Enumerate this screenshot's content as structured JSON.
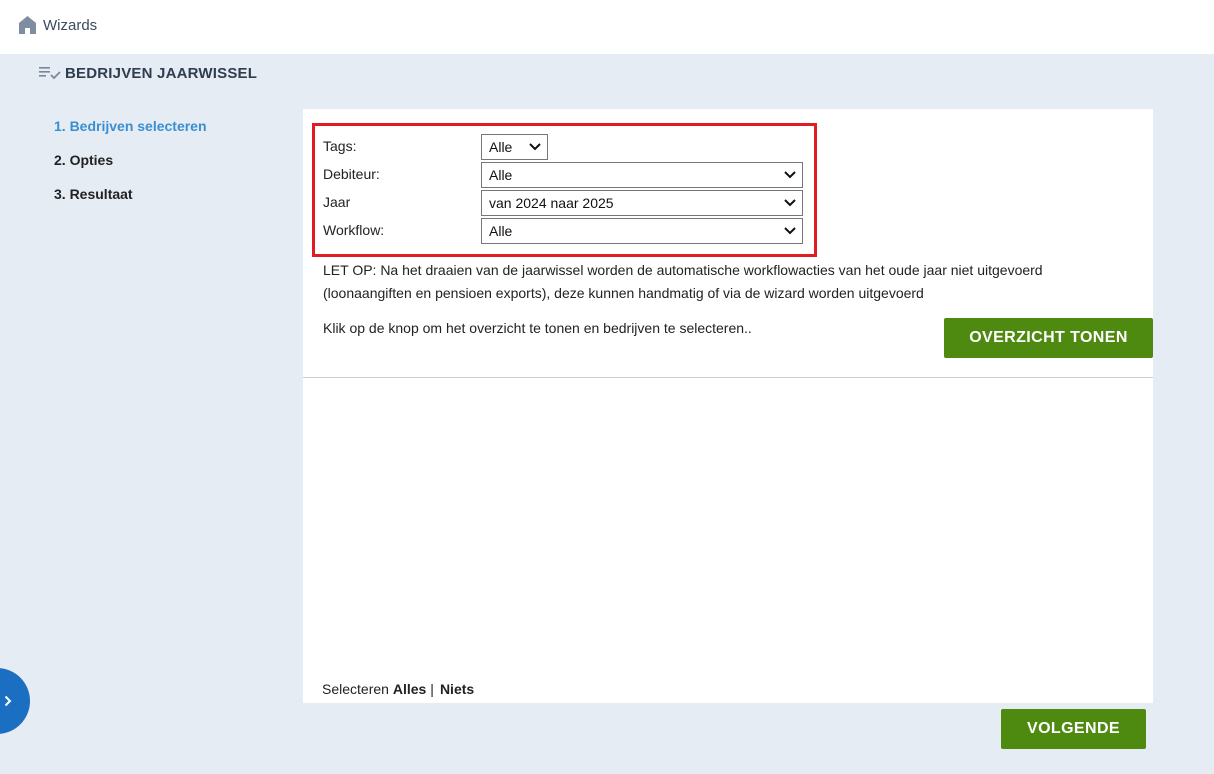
{
  "topbar": {
    "crumb": "Wizards"
  },
  "header": {
    "title": "BEDRIJVEN JAARWISSEL"
  },
  "steps": [
    {
      "label": "1. Bedrijven selecteren",
      "active": true
    },
    {
      "label": "2. Opties",
      "active": false
    },
    {
      "label": "3. Resultaat",
      "active": false
    }
  ],
  "filters": {
    "tags": {
      "label": "Tags:",
      "value": "Alle"
    },
    "debiteur": {
      "label": "Debiteur:",
      "value": "Alle"
    },
    "jaar": {
      "label": "Jaar",
      "value": "van 2024 naar 2025"
    },
    "workflow": {
      "label": "Workflow:",
      "value": "Alle"
    }
  },
  "notice": "LET OP: Na het draaien van de jaarwissel worden de automatische workflowacties van het oude jaar niet uitgevoerd (loonaangiften en pensioen exports), deze kunnen handmatig of via de wizard worden uitgevoerd",
  "hint": "Klik op de knop om het overzicht te tonen en bedrijven te selecteren..",
  "buttons": {
    "overzicht": "OVERZICHT TONEN",
    "volgende": "VOLGENDE"
  },
  "selection": {
    "prefix": "Selecteren",
    "all": "Alles",
    "separator": "|",
    "none": "Niets"
  },
  "colors": {
    "accent": "#3a8fd0",
    "button": "#4f8a10",
    "highlight": "#e31b23",
    "sidetab": "#1b6fc2"
  },
  "icons": {
    "home": "home-icon",
    "list": "list-check-icon",
    "chevron": "chevron-down-icon",
    "sidetab": "chevron-right-icon"
  }
}
